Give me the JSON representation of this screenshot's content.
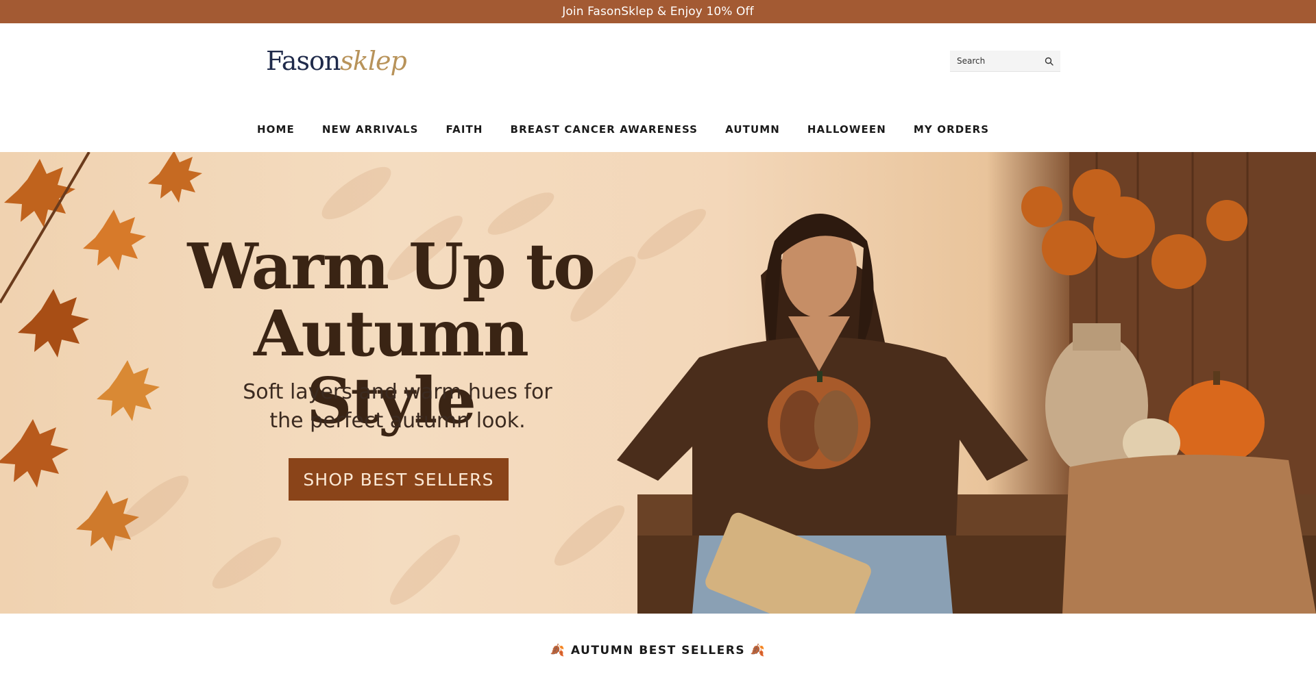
{
  "announcement": {
    "text": "Join FasonSklep & Enjoy 10% Off"
  },
  "header": {
    "logo": {
      "part1": "Fason",
      "part2": "sklep",
      "alt": "FasonSklep"
    },
    "search": {
      "placeholder": "Search",
      "value": ""
    },
    "nav": [
      {
        "label": "HOME"
      },
      {
        "label": "NEW ARRIVALS"
      },
      {
        "label": "FAITH"
      },
      {
        "label": "BREAST CANCER AWARENESS"
      },
      {
        "label": "AUTUMN"
      },
      {
        "label": "HALLOWEEN"
      },
      {
        "label": "MY ORDERS"
      }
    ]
  },
  "hero": {
    "title_line1": "Warm Up to",
    "title_line2": "Autumn Style",
    "subtitle_line1": "Soft layers and warm hues for",
    "subtitle_line2": "the perfect autumn look.",
    "cta": "SHOP BEST SELLERS"
  },
  "section": {
    "title": "AUTUMN BEST SELLERS",
    "leaf_left": "🍂",
    "leaf_right": "🍂"
  },
  "colors": {
    "announce_bg": "#a35a33",
    "cta_bg": "#8a4419",
    "text_dark": "#3a2414"
  },
  "icons": {
    "search": "search-icon",
    "leaf": "leaf-icon"
  }
}
